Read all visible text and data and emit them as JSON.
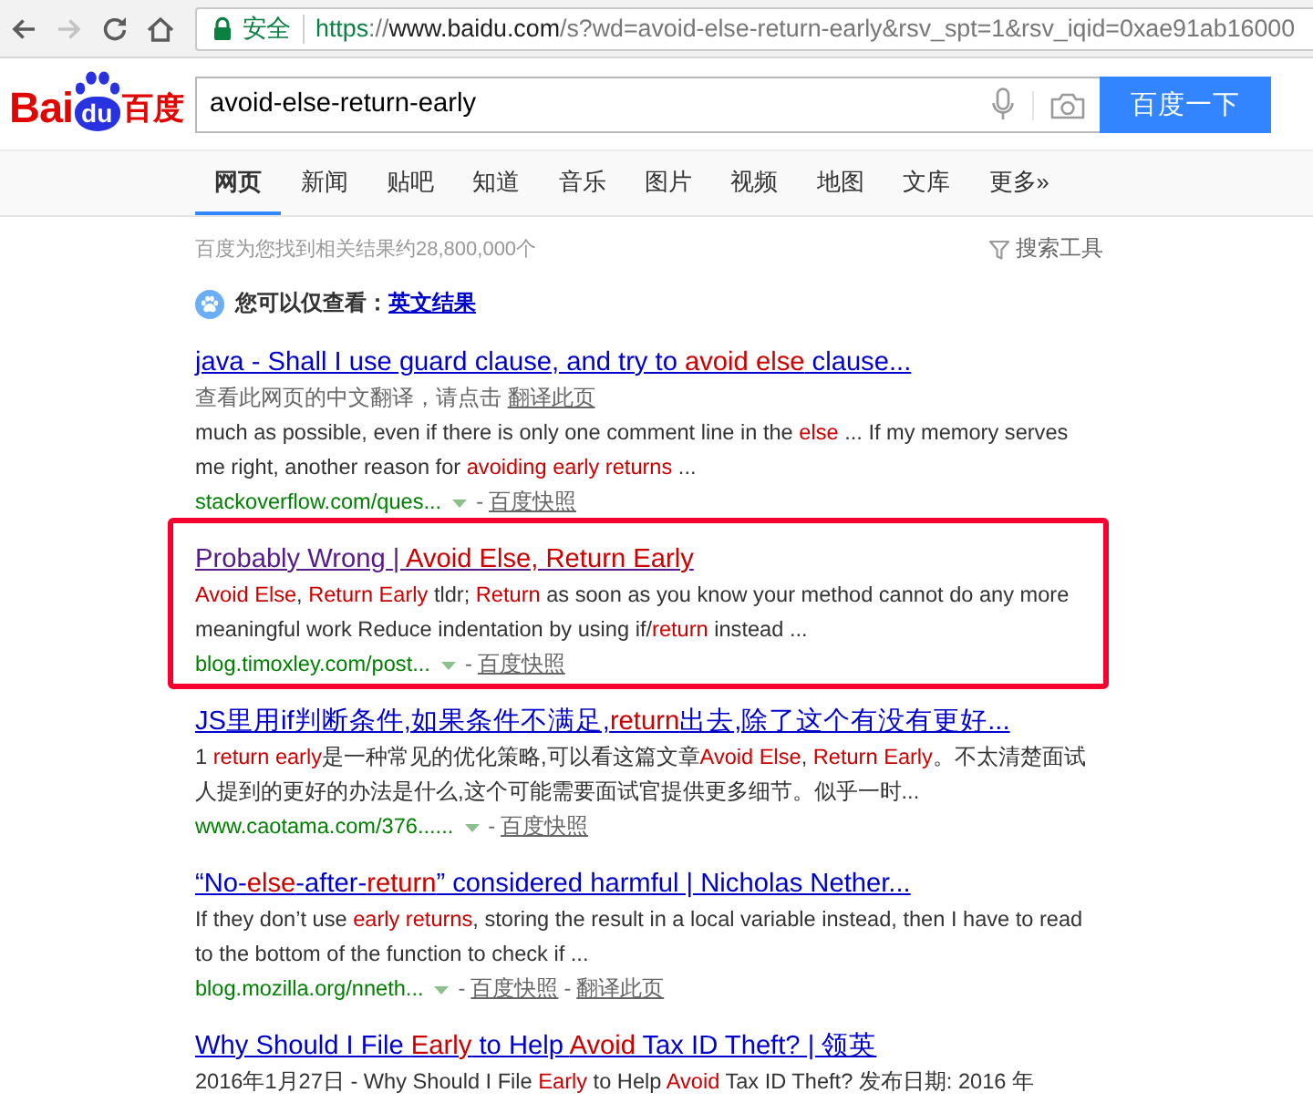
{
  "browser": {
    "nav_buttons": [
      {
        "kind": "back",
        "disabled": false
      },
      {
        "kind": "forward",
        "disabled": true
      },
      {
        "kind": "reload",
        "disabled": false
      },
      {
        "kind": "home",
        "disabled": false
      }
    ],
    "address_bar": {
      "security_label": "安全",
      "url_parts": [
        {
          "kind": "scheme",
          "text": "https"
        },
        {
          "kind": "separator",
          "text": "://"
        },
        {
          "kind": "host",
          "text": "www.baidu.com"
        },
        {
          "kind": "path",
          "text": "/s?wd=avoid-else-return-early&rsv_spt=1&rsv_iqid=0xae91ab16000"
        }
      ]
    }
  },
  "header": {
    "logo": {
      "left": "Bai",
      "badge": "du",
      "right": "百度"
    },
    "search": {
      "value": "avoid-else-return-early",
      "button": "百度一下"
    }
  },
  "tabs": [
    {
      "label": "网页",
      "selected": true
    },
    {
      "label": "新闻",
      "selected": false
    },
    {
      "label": "贴吧",
      "selected": false
    },
    {
      "label": "知道",
      "selected": false
    },
    {
      "label": "音乐",
      "selected": false
    },
    {
      "label": "图片",
      "selected": false
    },
    {
      "label": "视频",
      "selected": false
    },
    {
      "label": "地图",
      "selected": false
    },
    {
      "label": "文库",
      "selected": false
    },
    {
      "label": "更多»",
      "selected": false
    }
  ],
  "stats": {
    "count": "百度为您找到相关结果约28,800,000个",
    "tools": "搜索工具"
  },
  "language_hint": {
    "label": "您可以仅查看：",
    "link": "英文结果"
  },
  "results": [
    {
      "visited": false,
      "outlined": false,
      "title": [
        {
          "text": "java - Shall I use guard clause, and try to ",
          "highlight": false
        },
        {
          "text": "avoid else",
          "highlight": true
        },
        {
          "text": " clause...",
          "highlight": false
        }
      ],
      "translate_note": {
        "text": "查看此网页的中文翻译，请点击",
        "link": "翻译此页"
      },
      "snippet": [
        {
          "text": "much as possible, even if there is only one comment line in the ",
          "highlight": false
        },
        {
          "text": "else",
          "highlight": true
        },
        {
          "text": " ... If my memory serves me right, another reason for ",
          "highlight": false
        },
        {
          "text": "avoiding early returns",
          "highlight": true
        },
        {
          "text": " ...",
          "highlight": false
        }
      ],
      "url": "stackoverflow.com/ques...",
      "actions": [
        {
          "separator": "-",
          "label": "百度快照"
        }
      ]
    },
    {
      "visited": true,
      "outlined": true,
      "title": [
        {
          "text": "Probably Wrong | ",
          "highlight": false
        },
        {
          "text": "Avoid Else, Return Early",
          "highlight": true
        }
      ],
      "snippet": [
        {
          "text": "Avoid Else",
          "highlight": true
        },
        {
          "text": ", ",
          "highlight": false
        },
        {
          "text": "Return Early",
          "highlight": true
        },
        {
          "text": " tldr; ",
          "highlight": false
        },
        {
          "text": "Return",
          "highlight": true
        },
        {
          "text": " as soon as you know your method cannot do any more meaningful work Reduce indentation by using if/",
          "highlight": false
        },
        {
          "text": "return",
          "highlight": true
        },
        {
          "text": " instead ...",
          "highlight": false
        }
      ],
      "url": "blog.timoxley.com/post...",
      "actions": [
        {
          "separator": "-",
          "label": "百度快照"
        }
      ]
    },
    {
      "visited": false,
      "outlined": false,
      "title": [
        {
          "text": "JS里用if判断条件,如果条件不满足,",
          "highlight": false
        },
        {
          "text": "return",
          "highlight": true
        },
        {
          "text": "出去,除了这个有没有更好...",
          "highlight": false
        }
      ],
      "snippet": [
        {
          "text": "1 ",
          "highlight": false
        },
        {
          "text": "return early",
          "highlight": true
        },
        {
          "text": "是一种常见的优化策略,可以看这篇文章",
          "highlight": false
        },
        {
          "text": "Avoid Else",
          "highlight": true
        },
        {
          "text": ", ",
          "highlight": false
        },
        {
          "text": "Return Early",
          "highlight": true
        },
        {
          "text": "。不太清楚面试人提到的更好的办法是什么,这个可能需要面试官提供更多细节。似乎一时...",
          "highlight": false
        }
      ],
      "url": "www.caotama.com/376......",
      "actions": [
        {
          "separator": "-",
          "label": "百度快照"
        }
      ]
    },
    {
      "visited": false,
      "outlined": false,
      "title": [
        {
          "text": "“No-",
          "highlight": false
        },
        {
          "text": "else",
          "highlight": true
        },
        {
          "text": "-after-",
          "highlight": false
        },
        {
          "text": "return",
          "highlight": true
        },
        {
          "text": "” considered harmful | Nicholas Nether...",
          "highlight": false
        }
      ],
      "snippet": [
        {
          "text": "If they don’t use ",
          "highlight": false
        },
        {
          "text": "early returns",
          "highlight": true
        },
        {
          "text": ", storing the result in a local variable instead, then I have to read to the bottom of the function to check if ...",
          "highlight": false
        }
      ],
      "url": "blog.mozilla.org/nneth...",
      "actions": [
        {
          "separator": "-",
          "label": "百度快照"
        },
        {
          "separator": "-",
          "label": "翻译此页"
        }
      ]
    },
    {
      "visited": false,
      "outlined": false,
      "title": [
        {
          "text": "Why Should I File ",
          "highlight": false
        },
        {
          "text": "Early",
          "highlight": true
        },
        {
          "text": " to Help ",
          "highlight": false
        },
        {
          "text": "Avoid",
          "highlight": true
        },
        {
          "text": " Tax ID Theft? | 领英",
          "highlight": false
        }
      ],
      "snippet": [
        {
          "text": "2016年1月27日 - Why Should I File ",
          "highlight": false
        },
        {
          "text": "Early",
          "highlight": true
        },
        {
          "text": " to Help ",
          "highlight": false
        },
        {
          "text": "Avoid",
          "highlight": true
        },
        {
          "text": " Tax ID Theft? 发布日期: 2016 年",
          "highlight": false
        }
      ]
    }
  ]
}
